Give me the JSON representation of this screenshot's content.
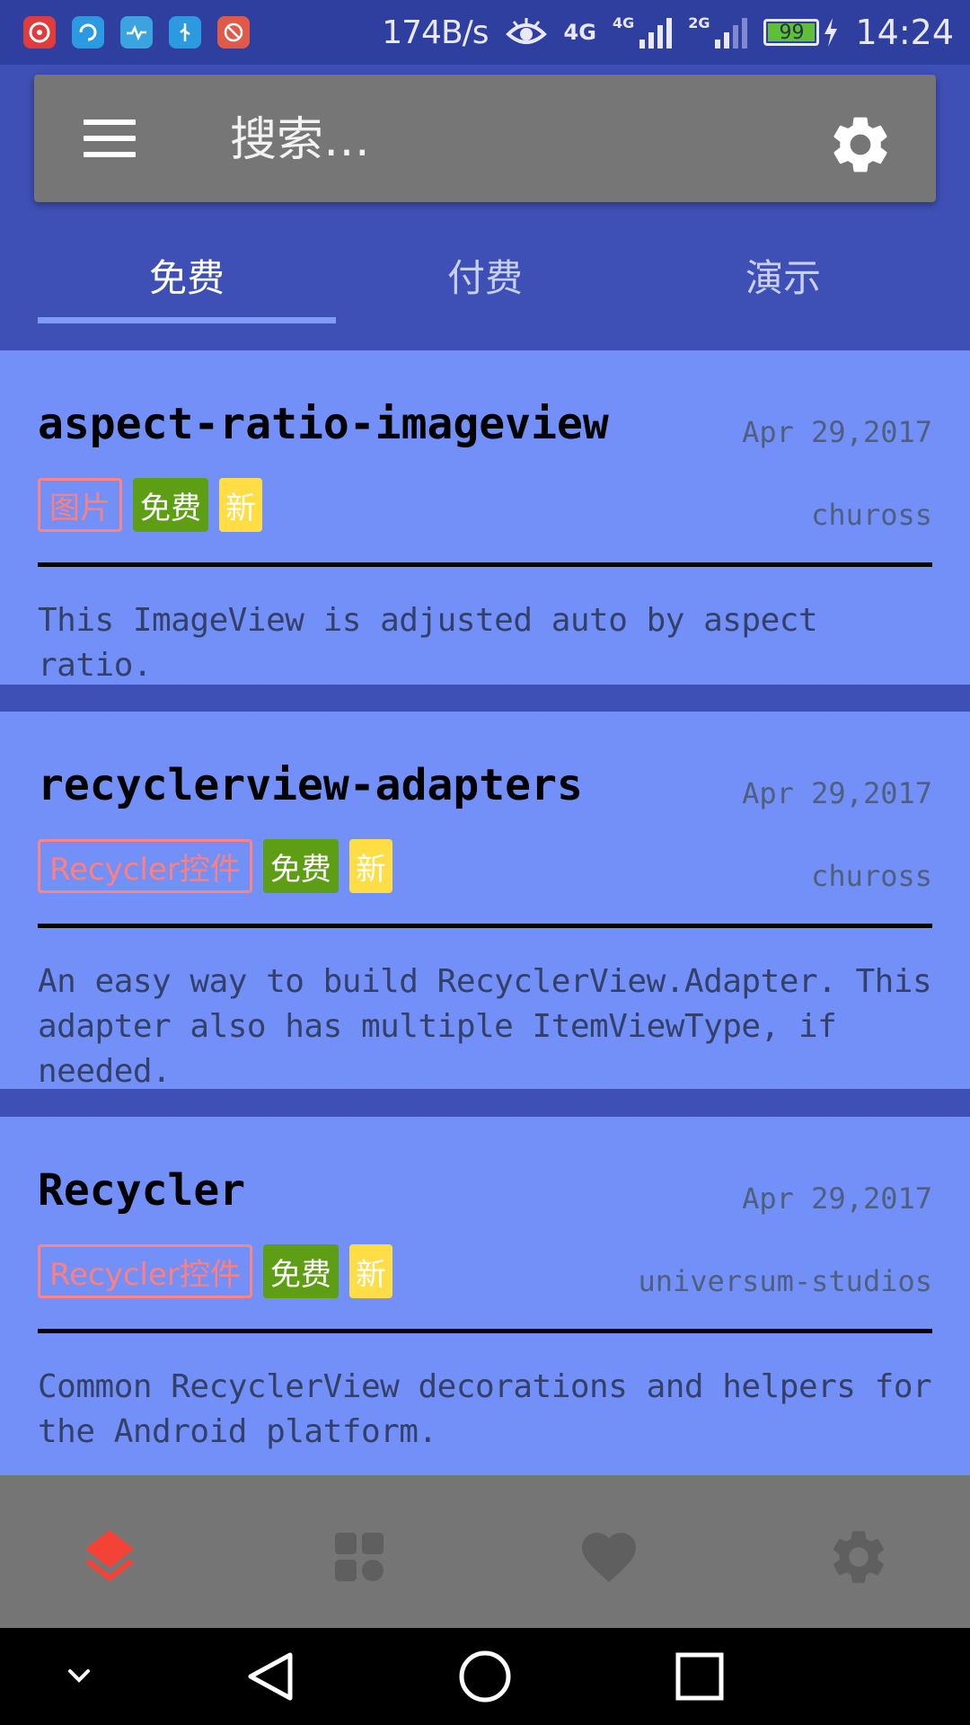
{
  "status_bar": {
    "net_speed": "174B/s",
    "signal_1_label": "4G",
    "signal_2_label": "4G",
    "signal_3_label": "2G",
    "battery": "99",
    "time": "14:24",
    "app_icons": [
      "netease-music-icon",
      "swirl-app-icon",
      "health-app-icon",
      "usb-icon",
      "blocked-app-icon"
    ]
  },
  "toolbar": {
    "search_placeholder": "搜索…"
  },
  "tabs": [
    {
      "label": "免费",
      "active": true
    },
    {
      "label": "付费",
      "active": false
    },
    {
      "label": "演示",
      "active": false
    }
  ],
  "cards": [
    {
      "title": "aspect-ratio-imageview",
      "date": "Apr 29,2017",
      "author": "chuross",
      "tags": {
        "category": "图片",
        "price": "免费",
        "new": "新"
      },
      "description": "This ImageView is adjusted auto by aspect ratio."
    },
    {
      "title": "recyclerview-adapters",
      "date": "Apr 29,2017",
      "author": "chuross",
      "tags": {
        "category": "Recycler控件",
        "price": "免费",
        "new": "新"
      },
      "description": "An easy way to build RecyclerView.Adapter. This adapter also has multiple ItemViewType, if needed."
    },
    {
      "title": "Recycler",
      "date": "Apr 29,2017",
      "author": "universum-studios",
      "tags": {
        "category": "Recycler控件",
        "price": "免费",
        "new": "新"
      },
      "description": "Common RecyclerView decorations and helpers for the Android platform."
    }
  ],
  "bottom_nav": {
    "items": [
      "layers-icon",
      "grid-icon",
      "heart-icon",
      "gear-icon"
    ],
    "active_index": 0,
    "active_color": "#f44336",
    "inactive_color": "#5f5f5f"
  },
  "colors": {
    "primary": "#3e50b5",
    "status_bar": "#2f3f9f",
    "card_background": "#7290f7",
    "free_tag": "#5d9e14",
    "new_tag": "#ffde45",
    "category_tag": "#ff7f7f"
  }
}
